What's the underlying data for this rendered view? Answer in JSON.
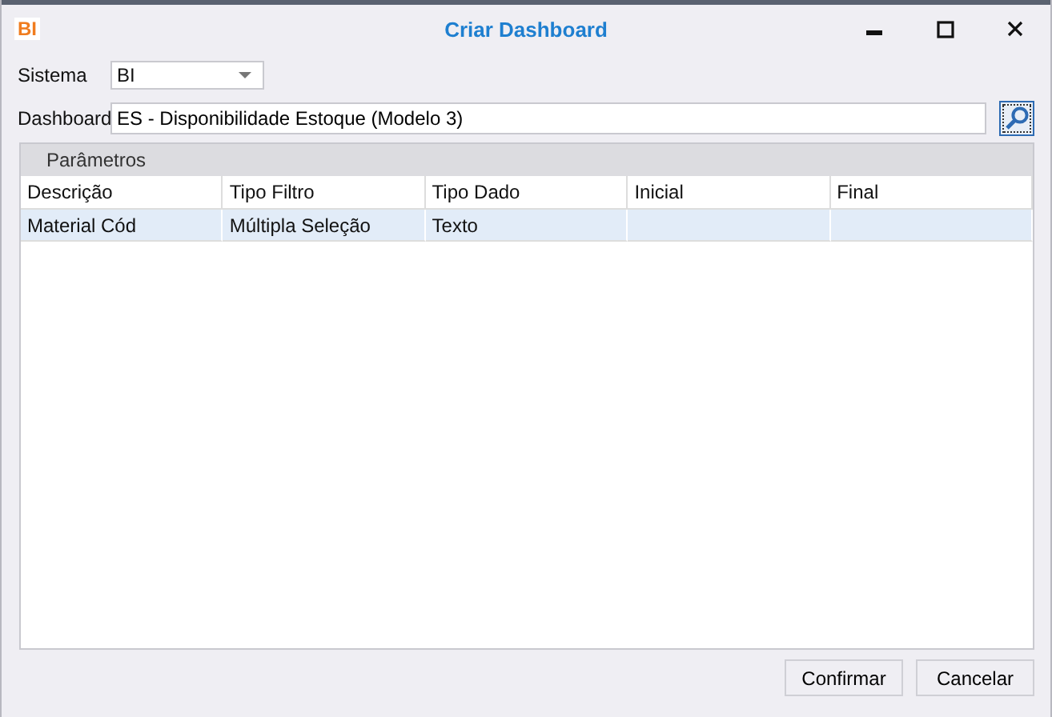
{
  "window": {
    "logo": "BI",
    "title": "Criar Dashboard"
  },
  "sistema": {
    "label": "Sistema",
    "value": "BI"
  },
  "dashboard": {
    "label": "Dashboard",
    "value": "ES - Disponibilidade Estoque (Modelo 3)"
  },
  "parametros": {
    "title": "Parâmetros",
    "columns": [
      "Descrição",
      "Tipo Filtro",
      "Tipo Dado",
      "Inicial",
      "Final"
    ],
    "rows": [
      {
        "cells": [
          "Material Cód",
          "Múltipla Seleção",
          "Texto",
          "",
          ""
        ],
        "selected": true
      }
    ]
  },
  "buttons": [
    "Confirmar",
    "Cancelar"
  ]
}
